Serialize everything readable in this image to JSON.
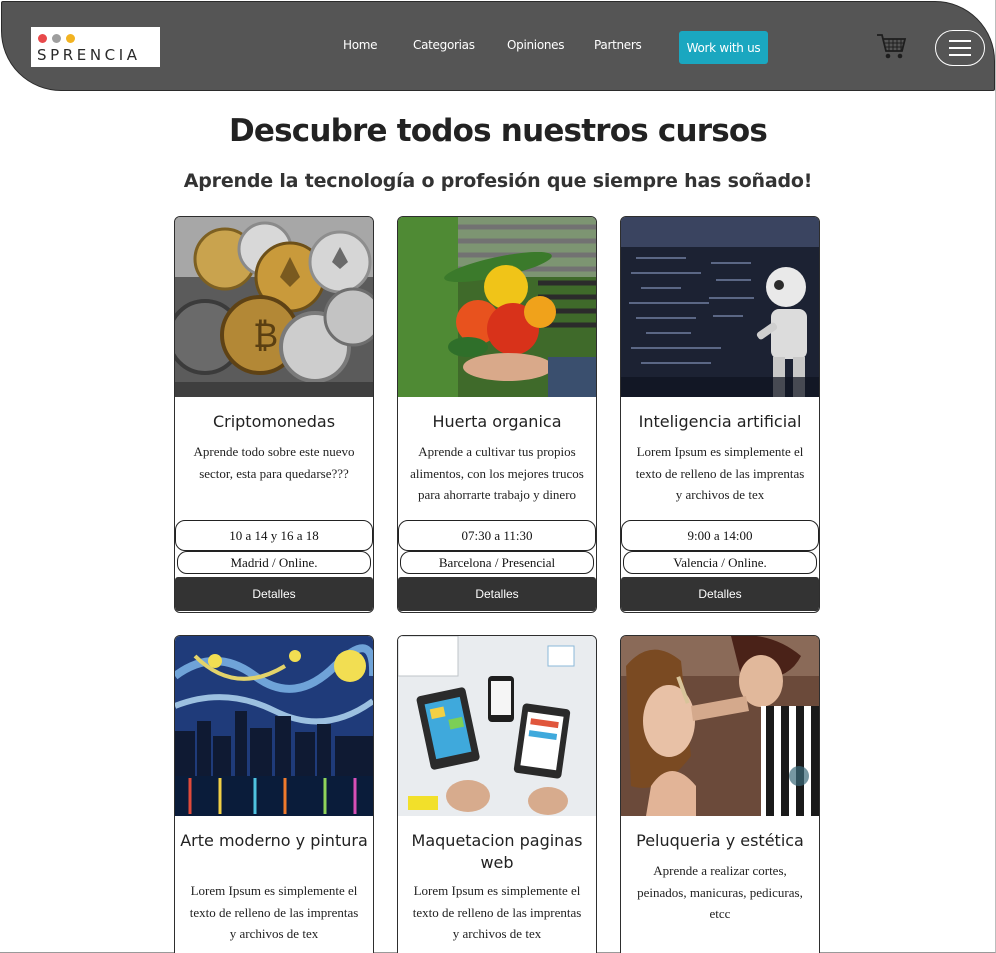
{
  "colors": {
    "navbar_bg": "#555555",
    "accent": "#1aa7c0",
    "logo_dots": [
      "#e8494b",
      "#9e9e9e",
      "#f2b321"
    ],
    "details_bg": "#333333"
  },
  "navbar": {
    "logo_text": "SPRENCIA",
    "links": [
      "Home",
      "Categorias",
      "Opiniones",
      "Partners"
    ],
    "cta_label": "Work with us",
    "cart_icon": "shopping-cart-icon",
    "menu_icon": "hamburger-menu-icon"
  },
  "hero": {
    "title": "Descubre todos nuestros cursos",
    "subtitle": "Aprende la tecnología o profesión que siempre has soñado!"
  },
  "courses": [
    {
      "title": "Criptomonedas",
      "description": "Aprende todo sobre este nuevo sector, esta para quedarse???",
      "schedule": "10 a 14 y 16 a 18",
      "location": "Madrid / Online.",
      "button": "Detalles",
      "image": "crypto-coins-image"
    },
    {
      "title": "Huerta organica",
      "description": "Aprende a cultivar tus propios alimentos, con los mejores trucos para ahorrarte trabajo y dinero",
      "schedule": "07:30 a 11:30",
      "location": "Barcelona / Presencial",
      "button": "Detalles",
      "image": "vegetables-image"
    },
    {
      "title": "Inteligencia artificial",
      "description": "Lorem Ipsum es simplemente el texto de relleno de las imprentas y archivos de tex",
      "schedule": "9:00 a 14:00",
      "location": "Valencia / Online.",
      "button": "Detalles",
      "image": "robot-image"
    },
    {
      "title": "Arte moderno y pintura",
      "description": "Lorem Ipsum es simplemente el texto de relleno de las imprentas y archivos de tex",
      "image": "starry-city-painting-image"
    },
    {
      "title": "Maquetacion paginas web",
      "description": "Lorem Ipsum es simplemente el texto de relleno de las imprentas y archivos de tex",
      "image": "web-wireframe-image"
    },
    {
      "title": "Peluqueria y estética",
      "description": "Aprende a realizar cortes, peinados, manicuras, pedicuras, etcc",
      "image": "makeup-image"
    }
  ]
}
